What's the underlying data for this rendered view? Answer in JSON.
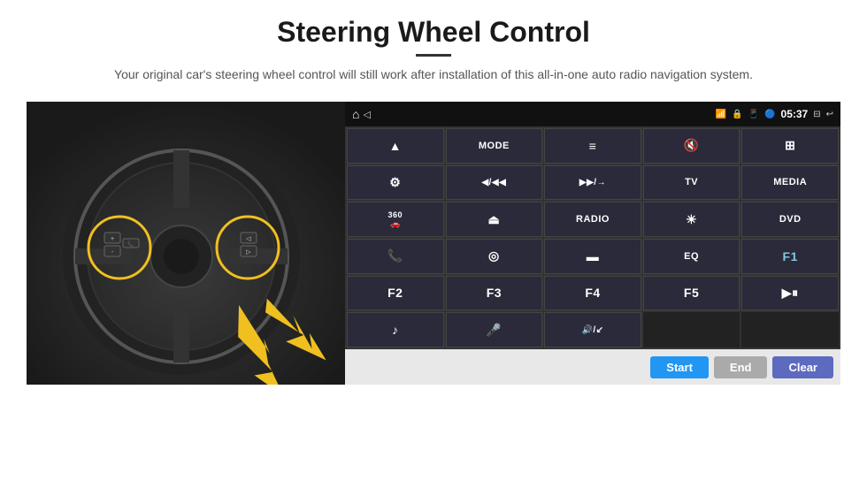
{
  "header": {
    "title": "Steering Wheel Control",
    "subtitle": "Your original car's steering wheel control will still work after installation of this all-in-one auto radio navigation system."
  },
  "statusBar": {
    "time": "05:37",
    "homeIcon": "⌂"
  },
  "controlButtons": [
    {
      "id": "b1",
      "label": "▲",
      "type": "icon"
    },
    {
      "id": "b2",
      "label": "MODE",
      "type": "text"
    },
    {
      "id": "b3",
      "label": "≡",
      "type": "icon"
    },
    {
      "id": "b4",
      "label": "🔇",
      "type": "icon"
    },
    {
      "id": "b5",
      "label": "⊞",
      "type": "icon"
    },
    {
      "id": "b6",
      "label": "⚙",
      "type": "icon"
    },
    {
      "id": "b7",
      "label": "◀/◀◀",
      "type": "text"
    },
    {
      "id": "b8",
      "label": "▶▶/→",
      "type": "text"
    },
    {
      "id": "b9",
      "label": "TV",
      "type": "text"
    },
    {
      "id": "b10",
      "label": "MEDIA",
      "type": "text"
    },
    {
      "id": "b11",
      "label": "360",
      "type": "text"
    },
    {
      "id": "b12",
      "label": "▲",
      "type": "icon"
    },
    {
      "id": "b13",
      "label": "RADIO",
      "type": "text"
    },
    {
      "id": "b14",
      "label": "☀",
      "type": "icon"
    },
    {
      "id": "b15",
      "label": "DVD",
      "type": "text"
    },
    {
      "id": "b16",
      "label": "📞",
      "type": "icon"
    },
    {
      "id": "b17",
      "label": "◎",
      "type": "icon"
    },
    {
      "id": "b18",
      "label": "▬",
      "type": "icon"
    },
    {
      "id": "b19",
      "label": "EQ",
      "type": "text"
    },
    {
      "id": "b20",
      "label": "F1",
      "type": "text"
    },
    {
      "id": "b21",
      "label": "F2",
      "type": "text"
    },
    {
      "id": "b22",
      "label": "F3",
      "type": "text"
    },
    {
      "id": "b23",
      "label": "F4",
      "type": "text"
    },
    {
      "id": "b24",
      "label": "F5",
      "type": "text"
    },
    {
      "id": "b25",
      "label": "▶⏸",
      "type": "icon"
    },
    {
      "id": "b26",
      "label": "♪",
      "type": "icon"
    },
    {
      "id": "b27",
      "label": "🎤",
      "type": "icon"
    },
    {
      "id": "b28",
      "label": "🔊/↙",
      "type": "icon"
    },
    {
      "id": "b29",
      "label": "",
      "type": "empty"
    },
    {
      "id": "b30",
      "label": "",
      "type": "empty"
    }
  ],
  "actionBar": {
    "startLabel": "Start",
    "endLabel": "End",
    "clearLabel": "Clear"
  },
  "colors": {
    "accent": "#2196f3",
    "panelBg": "#1a1a2e",
    "btnBg": "#2a2a3a",
    "actionBarBg": "#e8e8e8"
  }
}
